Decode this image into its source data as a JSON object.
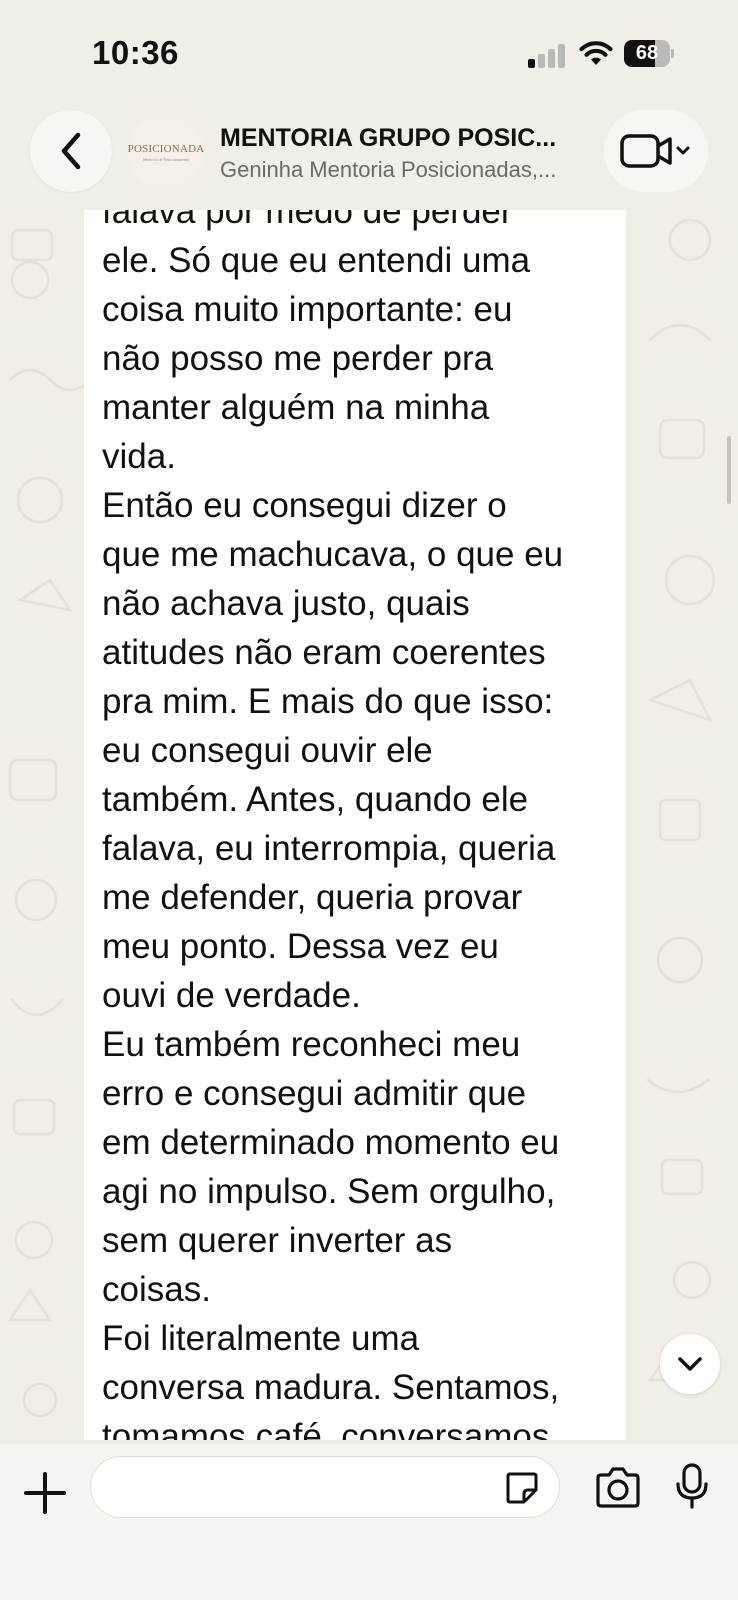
{
  "status_bar": {
    "time": "10:36",
    "battery_level": "68",
    "signal_bars_active": 1,
    "signal_bars_total": 4
  },
  "header": {
    "back_icon": "chevron-left-icon",
    "avatar_text": "POSICIONADA",
    "avatar_subtext": "Mentoria de Posicionamento",
    "title": "MENTORIA GRUPO POSIC...",
    "subtitle": "Geninha Mentoria Posicionadas,...",
    "video_icon": "video-camera-icon"
  },
  "message": {
    "lines": [
      "falava por medo de perder",
      "ele. Só que eu entendi uma",
      "coisa muito importante: eu",
      "não posso me perder pra",
      "manter alguém na minha",
      "vida.",
      "Então eu consegui dizer o",
      "que me machucava, o que eu",
      "não achava justo, quais",
      "atitudes não eram coerentes",
      "pra mim. E mais do que isso:",
      "eu consegui ouvir ele",
      "também. Antes, quando ele",
      "falava, eu interrompia, queria",
      "me defender, queria provar",
      "meu ponto. Dessa vez eu",
      "ouvi de verdade.",
      "Eu também reconheci meu",
      "erro e consegui admitir que",
      "em determinado momento eu",
      "agi no impulso. Sem orgulho,",
      "sem querer inverter as",
      "coisas.",
      "Foi literalmente uma",
      "conversa madura. Sentamos,",
      "tomamos café, conversamos"
    ]
  },
  "input_bar": {
    "plus_icon": "plus-icon",
    "placeholder": "",
    "sticker_icon": "sticker-icon",
    "camera_icon": "camera-icon",
    "mic_icon": "microphone-icon"
  },
  "colors": {
    "background": "#f1ede7",
    "bubble": "#ffffff",
    "doodle": "#e7e1d8",
    "text": "#111111"
  }
}
